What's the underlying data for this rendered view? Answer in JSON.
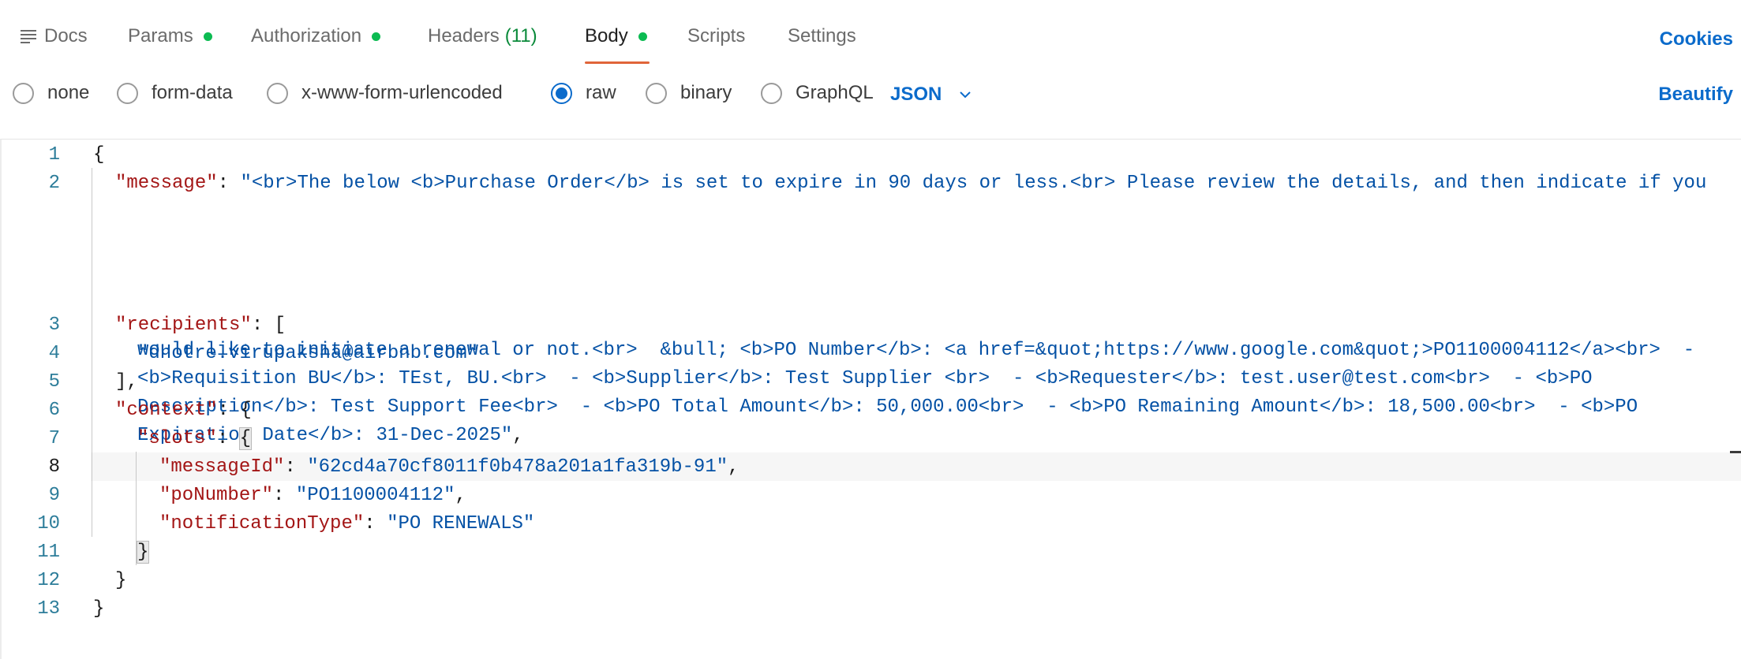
{
  "tabs": {
    "docs": "Docs",
    "params": "Params",
    "authorization": "Authorization",
    "headers": "Headers",
    "headers_count": "(11)",
    "body": "Body",
    "scripts": "Scripts",
    "settings": "Settings",
    "active": "Body",
    "cookies": "Cookies"
  },
  "body_types": {
    "options": [
      "none",
      "form-data",
      "x-www-form-urlencoded",
      "raw",
      "binary",
      "GraphQL"
    ],
    "selected": "raw",
    "format": "JSON",
    "beautify": "Beautify"
  },
  "editor": {
    "current_line": 8,
    "line_numbers": [
      "1",
      "2",
      "3",
      "4",
      "5",
      "6",
      "7",
      "8",
      "9",
      "10",
      "11",
      "12",
      "13"
    ],
    "l1": "{",
    "l2_key": "\"message\"",
    "l2_sep": ": ",
    "l2_val_1": "\"<br>The below <b>Purchase Order</b> is set to expire in 90 days or less.<br> Please review the details, and then indicate if you",
    "l2_val_2": "would like to initiate a renewal or not.<br>  &bull; <b>PO Number</b>: <a href=&quot;https://www.google.com&quot;>PO1100004112</a><br>  -",
    "l2_val_3": "<b>Requisition BU</b>: TEst, BU.<br>  - <b>Supplier</b>: Test Supplier <br>  - <b>Requester</b>: test.user@test.com<br>  - <b>PO",
    "l2_val_4": "Description</b>: Test Support Fee<br>  - <b>PO Total Amount</b>: 50,000.00<br>  - <b>PO Remaining Amount</b>: 18,500.00<br>  - <b>PO",
    "l2_val_5": "Expiration Date</b>: 31-Dec-2025\"",
    "l2_end": ",",
    "l3_key": "\"recipients\"",
    "l3_rest": ": [",
    "l4_val": "\"dhotre.virupaksha@airbnb.com\"",
    "l5": "],",
    "l6_key": "\"context\"",
    "l6_rest": ": {",
    "l7_key": "\"slots\"",
    "l7_sep": ": ",
    "l7_brace": "{",
    "l8_key": "\"messageId\"",
    "l8_sep": ": ",
    "l8_val": "\"62cd4a70cf8011f0b478a201a1fa319b-91\"",
    "l8_end": ",",
    "l9_key": "\"poNumber\"",
    "l9_sep": ": ",
    "l9_val": "\"PO1100004112\"",
    "l9_end": ",",
    "l10_key": "\"notificationType\"",
    "l10_sep": ": ",
    "l10_val": "\"PO RENEWALS\"",
    "l11": "}",
    "l12": "}",
    "l13": "}"
  },
  "colors": {
    "accent": "#0b6bcb",
    "status_dot": "#0cbb52",
    "active_tab_underline": "#e0653a",
    "json_key": "#a31515",
    "json_string": "#0451a5",
    "line_number": "#2d7d9a"
  },
  "icons": [
    "docs-lines-icon",
    "chevron-down-icon"
  ]
}
